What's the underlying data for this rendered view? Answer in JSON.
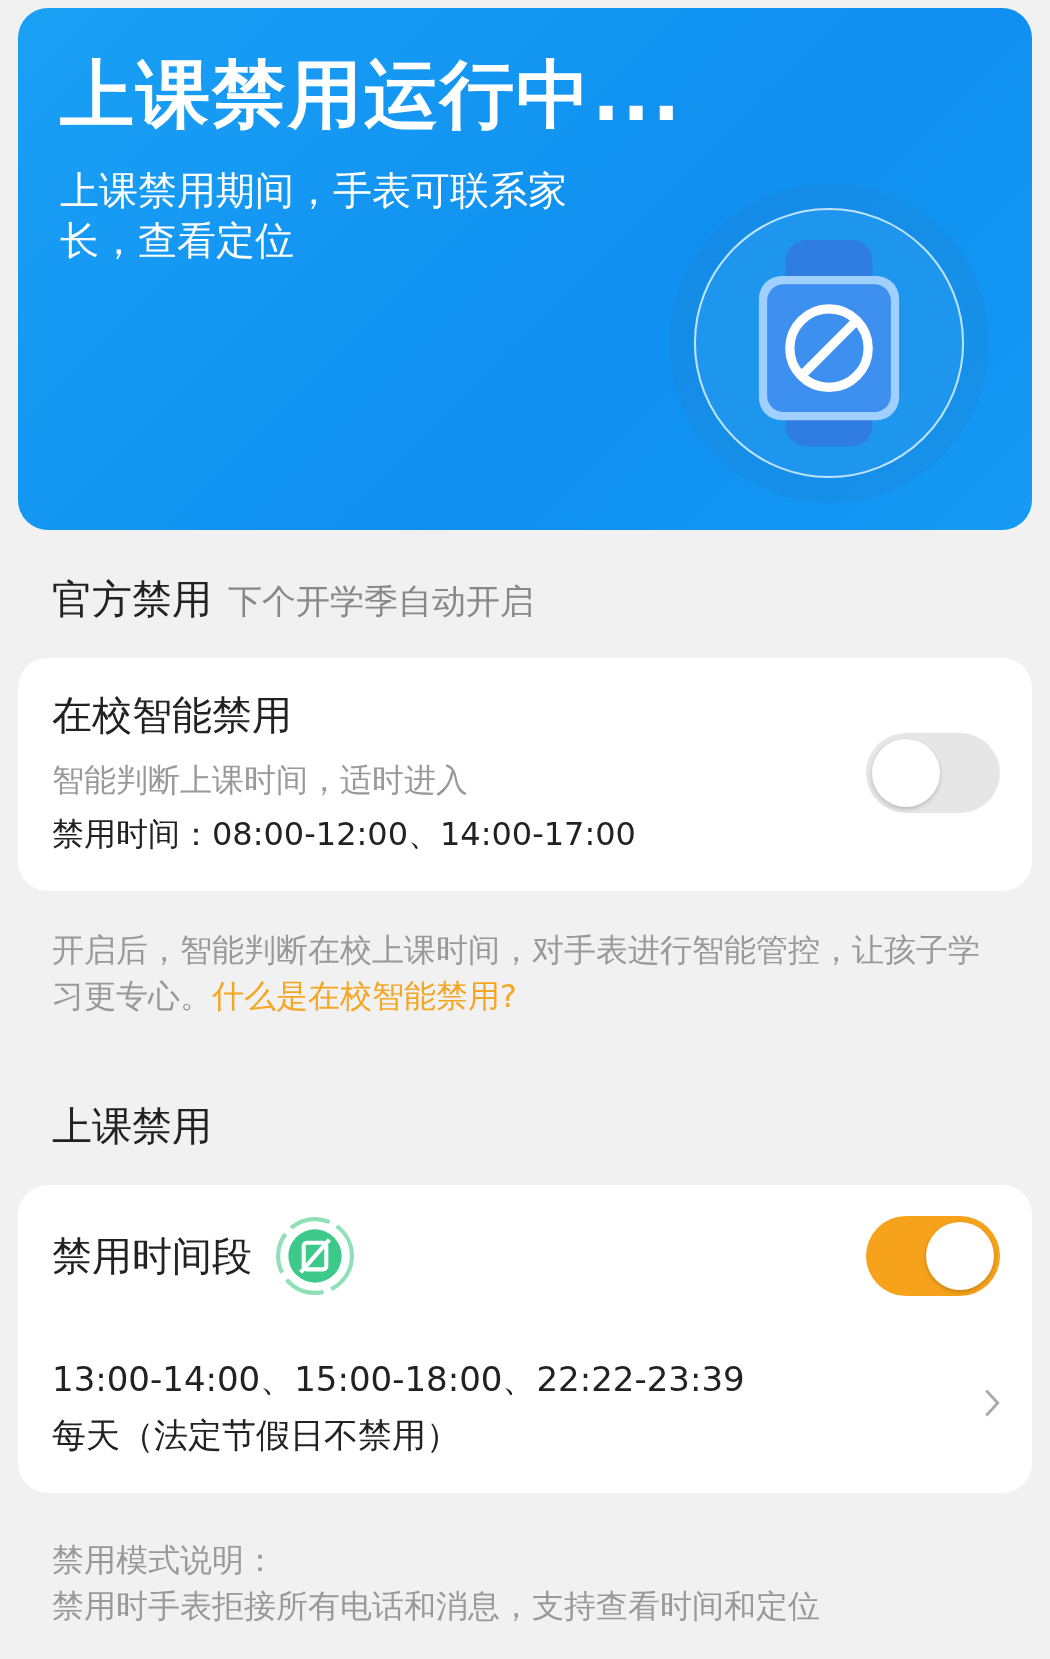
{
  "header": {
    "title": "上课禁用运行中...",
    "subtitle": "上课禁用期间，手表可联系家长，查看定位"
  },
  "official": {
    "title": "官方禁用",
    "hint": "下个开学季自动开启",
    "card": {
      "title": "在校智能禁用",
      "description": "智能判断上课时间，适时进入",
      "times": "禁用时间：08:00-12:00、14:00-17:00",
      "on": false
    },
    "note": "开启后，智能判断在校上课时间，对手表进行智能管控，让孩子学习更专心。",
    "link": "什么是在校智能禁用?"
  },
  "class": {
    "title": "上课禁用",
    "card": {
      "title": "禁用时间段",
      "on": true,
      "times": "13:00-14:00、15:00-18:00、22:22-23:39",
      "repeat": "每天（法定节假日不禁用）"
    }
  },
  "footer": {
    "title": "禁用模式说明：",
    "text": "禁用时手表拒接所有电话和消息，支持查看时间和定位"
  }
}
